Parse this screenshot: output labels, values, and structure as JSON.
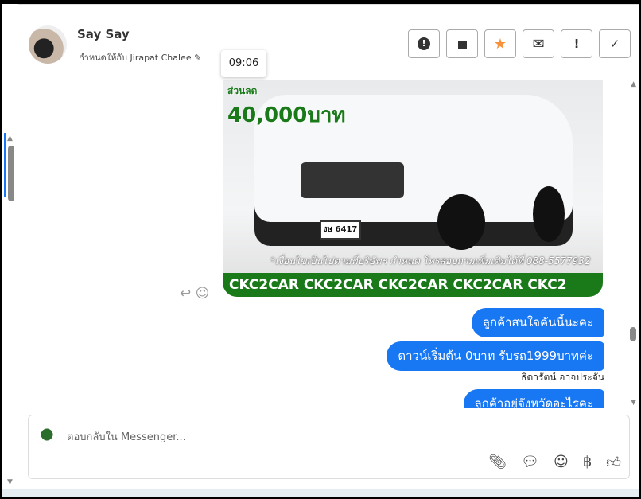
{
  "header": {
    "name": "Say Say",
    "assigned": "กำหนดให้กับ Jirapat Chalee",
    "tooltip": "09:06",
    "buttons": [
      {
        "icon": "alert-circle-icon",
        "glyph": "⬤"
      },
      {
        "icon": "trash-icon",
        "glyph": "🗑"
      },
      {
        "icon": "star-icon",
        "glyph": "★",
        "color": "#f7923a"
      },
      {
        "icon": "envelope-icon",
        "glyph": "✉"
      },
      {
        "icon": "exclamation-icon",
        "glyph": "!"
      },
      {
        "icon": "check-icon",
        "glyph": "✓"
      }
    ]
  },
  "image": {
    "promo_top": "ส่วนลด",
    "promo_amount": "40,000บาท",
    "plate": "งษ 6417",
    "condition": "*เงื่อนไขเป็นไปตามที่บริษัทฯ กำหนด โทรสอบถามเพิ่มเติมได้ที่ 088-5577932",
    "band": "CKC2CAR CKC2CAR CKC2CAR CKC2CAR CKC2"
  },
  "messages": [
    {
      "text": "ลูกค้าสนใจคันนี้นะคะ"
    },
    {
      "text": "ดาวน์เริ่มต้น 0บาท รับรถ1999บาทค่ะ"
    },
    {
      "text": "ลูกค้าอยู่จังหวัดอะไรคะ"
    }
  ],
  "sender": "ธิดารัตน์ อาจประจัน",
  "composer": {
    "placeholder": "ตอบกลับใน Messenger...",
    "tools": [
      "paperclip-icon",
      "message-icon",
      "smile-icon",
      "baht-icon",
      "thumbs-up-icon"
    ]
  },
  "colors": {
    "accent": "#1877f2",
    "star": "#f7923a"
  }
}
